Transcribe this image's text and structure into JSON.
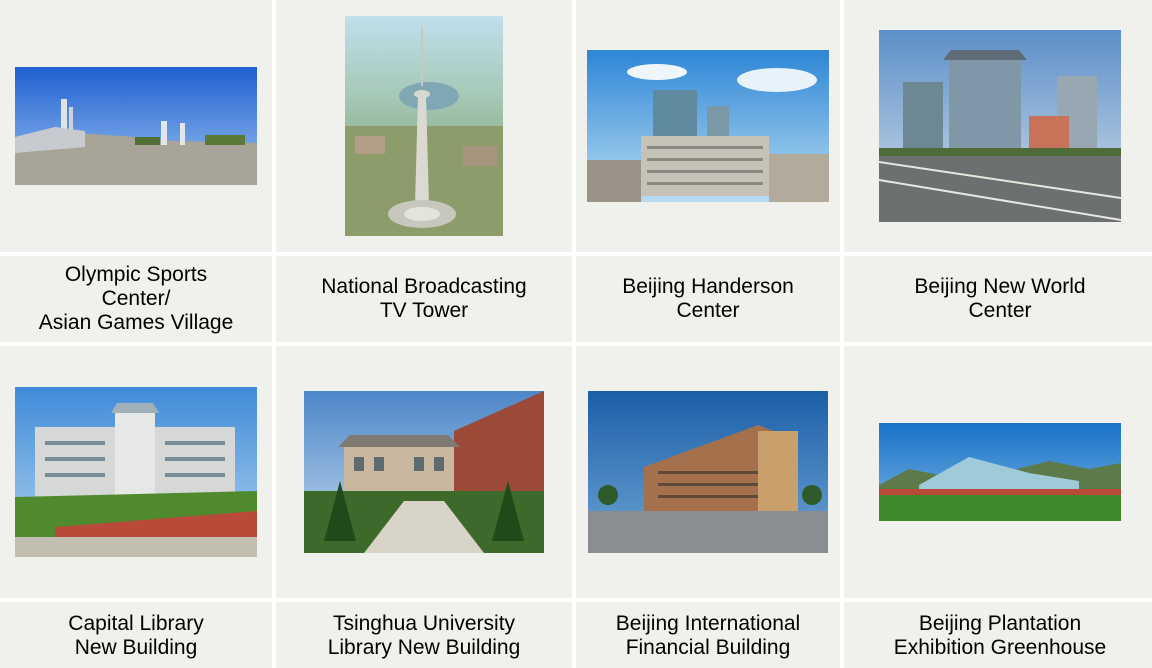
{
  "grid": {
    "row1": [
      {
        "caption": "Olympic Sports\nCenter/\nAsian Games Village",
        "photo_icon": "sports-center-photo"
      },
      {
        "caption": "National Broadcasting\nTV Tower",
        "photo_icon": "tv-tower-photo"
      },
      {
        "caption": "Beijing Handerson\nCenter",
        "photo_icon": "handerson-center-photo"
      },
      {
        "caption": "Beijing New World\nCenter",
        "photo_icon": "new-world-center-photo"
      }
    ],
    "row2": [
      {
        "caption": "Capital Library\nNew Building",
        "photo_icon": "capital-library-photo"
      },
      {
        "caption": "Tsinghua University\nLibrary New Building",
        "photo_icon": "tsinghua-library-photo"
      },
      {
        "caption": "Beijing International\nFinancial Building",
        "photo_icon": "financial-building-photo"
      },
      {
        "caption": "Beijing Plantation\nExhibition Greenhouse",
        "photo_icon": "greenhouse-photo"
      }
    ]
  },
  "colors": {
    "cell_background": "#f0f0ec",
    "grid_line": "#ffffff",
    "caption_text": "#000000"
  }
}
